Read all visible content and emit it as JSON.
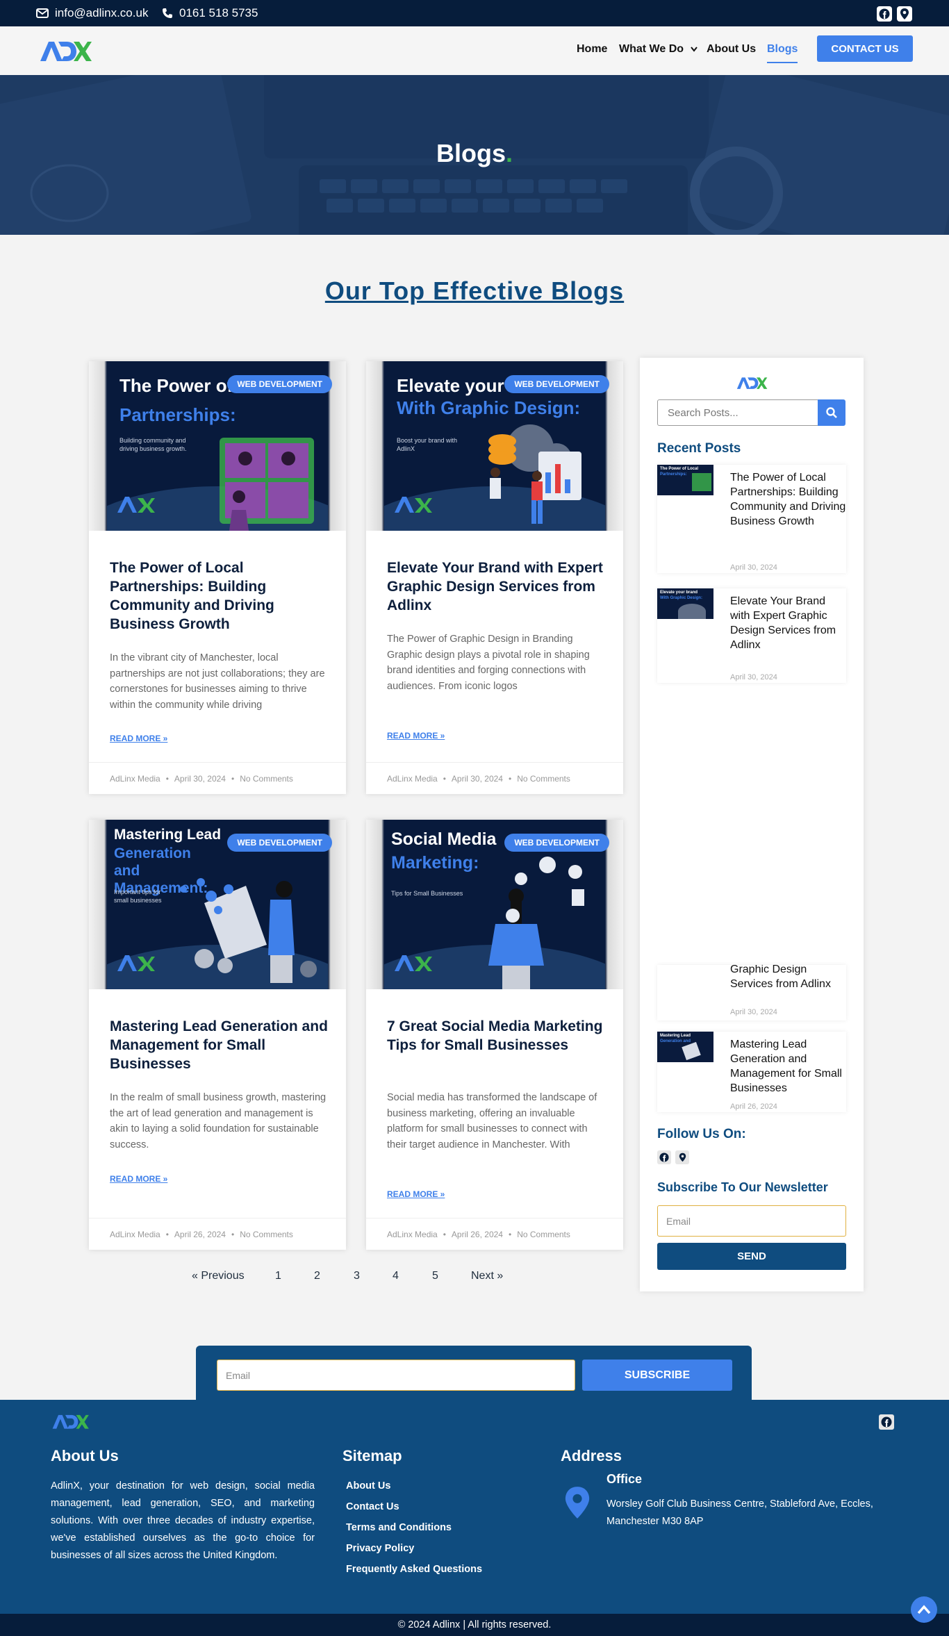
{
  "topbar": {
    "email": "info@adlinx.co.uk",
    "phone": "0161 518 5735",
    "icons": [
      "mail-icon",
      "phone-icon",
      "facebook-icon",
      "location-pin-icon"
    ]
  },
  "nav": {
    "logo_text": "ADX",
    "items": [
      "Home",
      "What We Do",
      "About Us",
      "Blogs"
    ],
    "active": "Blogs",
    "cta": "CONTACT US"
  },
  "hero": {
    "title": "Blogs",
    "dot": "."
  },
  "section": {
    "title": "Our Top Effective Blogs"
  },
  "posts": [
    {
      "image_title_a": "The Power of Lo",
      "image_title_b": "Partnerships:",
      "image_sub": "Building community and driving business growth.",
      "badge": "WEB DEVELOPMENT",
      "title": "The Power of Local Partnerships: Building Community and Driving Business Growth",
      "excerpt": "In the vibrant city of Manchester, local partnerships are not just collaborations; they are cornerstones for businesses aiming to thrive within the community while driving",
      "read_more": "READ MORE »",
      "author": "AdLinx Media",
      "date": "April 30, 2024",
      "comments": "No Comments"
    },
    {
      "image_title_a": "Elevate your bra",
      "image_title_b": "With Graphic Design:",
      "image_sub": "Boost your brand with AdlinX",
      "badge": "WEB DEVELOPMENT",
      "title": "Elevate Your Brand with Expert Graphic Design Services from Adlinx",
      "excerpt": "The Power of Graphic Design in Branding Graphic design plays a pivotal role in shaping brand identities and forging connections with audiences. From iconic logos",
      "read_more": "READ MORE »",
      "author": "AdLinx Media",
      "date": "April 30, 2024",
      "comments": "No Comments"
    },
    {
      "image_title_a": "Mastering Lead",
      "image_title_b": "Generation and Management:",
      "image_sub": "Important tips for small businesses",
      "badge": "WEB DEVELOPMENT",
      "title": "Mastering Lead Generation and Management for Small Businesses",
      "excerpt": "In the realm of small business growth, mastering the art of lead generation and management is akin to laying a solid foundation for sustainable success.",
      "read_more": "READ MORE »",
      "author": "AdLinx Media",
      "date": "April 26, 2024",
      "comments": "No Comments"
    },
    {
      "image_title_a": "Social Media",
      "image_title_b": "Marketing:",
      "image_sub": "Tips for Small Businesses",
      "badge": "WEB DEVELOPMENT",
      "title": "7 Great Social Media Marketing Tips for Small Businesses",
      "excerpt": "Social media has transformed the landscape of business marketing, offering an invaluable platform for small businesses to connect with their target audience in Manchester. With",
      "read_more": "READ MORE »",
      "author": "AdLinx Media",
      "date": "April 26, 2024",
      "comments": "No Comments"
    }
  ],
  "pagination": [
    "« Previous",
    "1",
    "2",
    "3",
    "4",
    "5",
    "Next »"
  ],
  "sidebar": {
    "search_placeholder": "Search Posts...",
    "recent_title": "Recent Posts",
    "recent": [
      {
        "title": "The Power of Local Partnerships: Building Community and Driving Business Growth",
        "date": "April 30, 2024"
      },
      {
        "title": "Elevate Your Brand with Expert Graphic Design Services from Adlinx",
        "date": "April 30, 2024"
      },
      {
        "title": "Graphic Design Services from Adlinx",
        "date": "April 30, 2024"
      },
      {
        "title": "Mastering Lead Generation and Management for Small Businesses",
        "date": "April 26, 2024"
      }
    ],
    "follow_title": "Follow Us On:",
    "newsletter_title": "Subscribe To Our Newsletter",
    "email_placeholder": "Email",
    "send": "SEND"
  },
  "subscribe": {
    "placeholder": "Email",
    "button": "SUBSCRIBE"
  },
  "footer": {
    "about_title": "About Us",
    "about_text": "AdlinX, your destination for web design, social media management, lead generation, SEO, and marketing solutions. With over three decades of industry expertise, we've established ourselves as the go-to choice for businesses of all sizes across the United Kingdom.",
    "sitemap_title": "Sitemap",
    "sitemap": [
      "About Us",
      "Contact Us",
      "Terms and Conditions",
      "Privacy Policy",
      "Frequently Asked Questions"
    ],
    "address_title": "Address",
    "office": "Office",
    "address": "Worsley Golf Club Business Centre, Stableford Ave, Eccles, Manchester M30 8AP"
  },
  "copyright": "© 2024 Adlinx | All rights reserved.",
  "colors": {
    "brand_dark": "#061d3b",
    "brand": "#0f4c7f",
    "accent": "#3f80ea",
    "logo_green": "#3cb44b"
  }
}
